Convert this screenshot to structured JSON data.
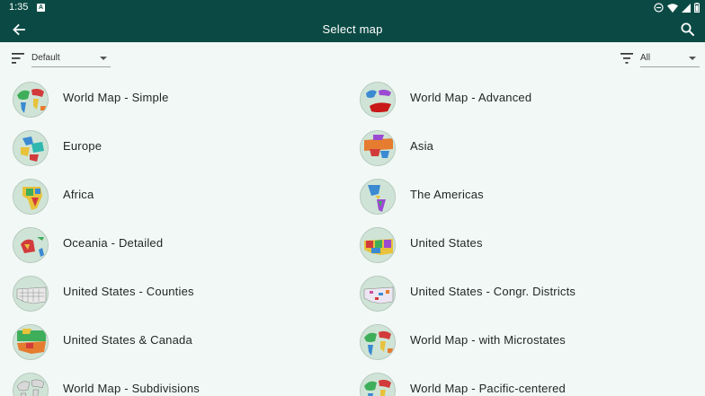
{
  "status": {
    "time": "1:35",
    "notif_badge": "A"
  },
  "header": {
    "title": "Select map"
  },
  "toolbar": {
    "sort_value": "Default",
    "filter_value": "All"
  },
  "maps": [
    {
      "label": "World Map - Simple",
      "thumb": "world"
    },
    {
      "label": "World Map - Advanced",
      "thumb": "world-red"
    },
    {
      "label": "Europe",
      "thumb": "europe"
    },
    {
      "label": "Asia",
      "thumb": "asia"
    },
    {
      "label": "Africa",
      "thumb": "africa"
    },
    {
      "label": "The Americas",
      "thumb": "americas"
    },
    {
      "label": "Oceania - Detailed",
      "thumb": "oceania"
    },
    {
      "label": "United States",
      "thumb": "usa"
    },
    {
      "label": "United States - Counties",
      "thumb": "usa-counties"
    },
    {
      "label": "United States - Congr. Districts",
      "thumb": "usa-districts"
    },
    {
      "label": "United States & Canada",
      "thumb": "usa-canada"
    },
    {
      "label": "World Map - with Microstates",
      "thumb": "world"
    },
    {
      "label": "World Map - Subdivisions",
      "thumb": "world-sub"
    },
    {
      "label": "World Map - Pacific-centered",
      "thumb": "world"
    }
  ]
}
